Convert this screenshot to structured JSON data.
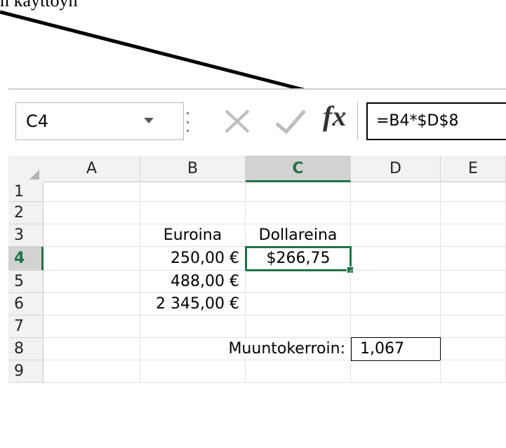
{
  "top_text": "n kayttoyh",
  "formula_bar": {
    "name_box": "C4",
    "formula": "=B4*$D$8",
    "cancel_icon": "x-cancel-icon",
    "enter_icon": "check-enter-icon",
    "fx_label": "fx"
  },
  "columns": [
    "A",
    "B",
    "C",
    "D",
    "E"
  ],
  "rows": [
    "1",
    "2",
    "3",
    "4",
    "5",
    "6",
    "7",
    "8",
    "9"
  ],
  "selected": {
    "column": "C",
    "row": "4"
  },
  "cells": {
    "B3": "Euroina",
    "C3": "Dollareina",
    "B4": "250,00 €",
    "C4": "$266,75",
    "B5": "488,00 €",
    "B6": "2 345,00 €",
    "C8": "Muuntokerroin:",
    "D8": "1,067"
  },
  "colors": {
    "accent": "#217346",
    "header_bg": "#f2f2f2",
    "selected_header_bg": "#d2d2d2",
    "gridline": "#e1e1e1"
  }
}
